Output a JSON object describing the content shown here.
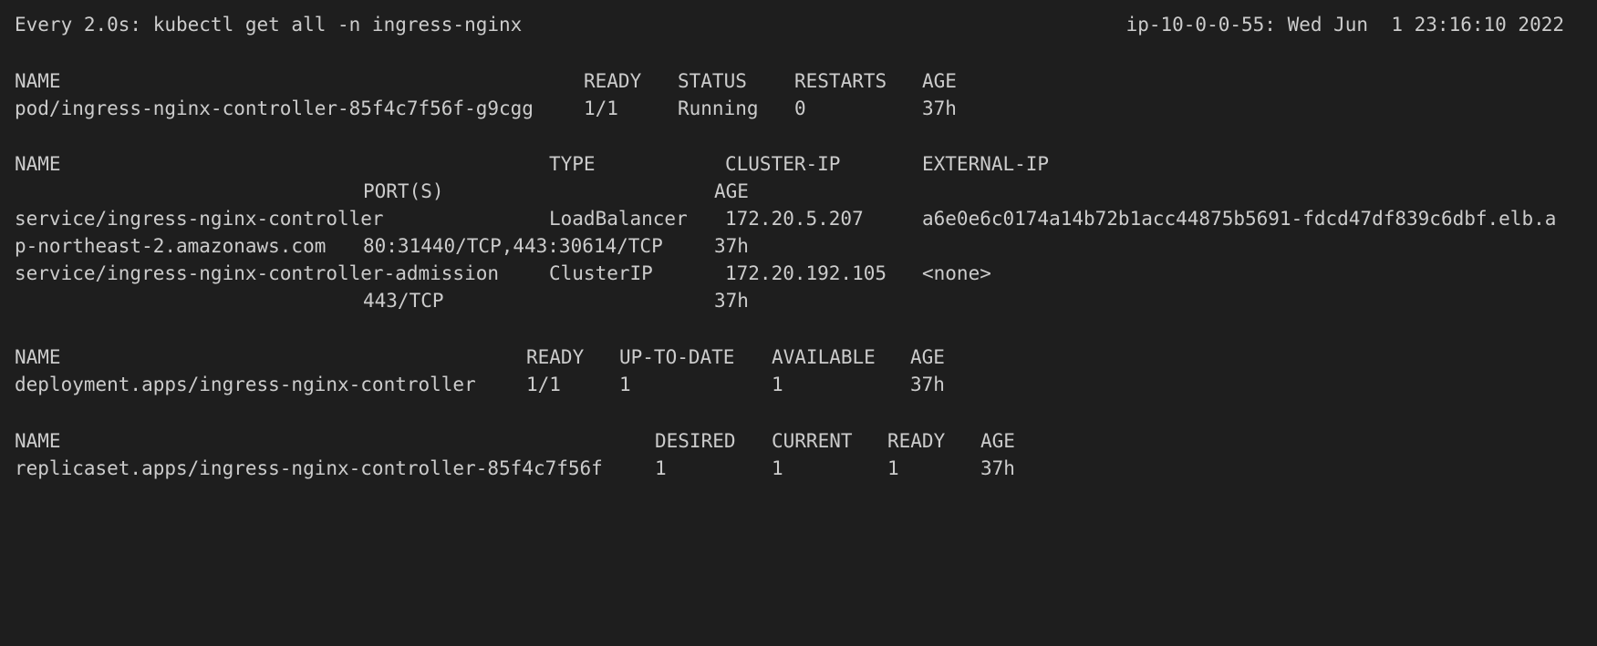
{
  "watch": {
    "left": "Every 2.0s: kubectl get all -n ingress-nginx",
    "right": "ip-10-0-0-55: Wed Jun  1 23:16:10 2022"
  },
  "pods": {
    "headers": [
      "NAME",
      "READY",
      "STATUS",
      "RESTARTS",
      "AGE"
    ],
    "rows": [
      [
        "pod/ingress-nginx-controller-85f4c7f56f-g9cgg",
        "1/1",
        "Running",
        "0",
        "37h"
      ]
    ]
  },
  "services": {
    "headers": [
      "NAME",
      "TYPE",
      "CLUSTER-IP",
      "EXTERNAL-IP",
      "PORT(S)",
      "AGE"
    ],
    "rows": [
      {
        "name": "service/ingress-nginx-controller",
        "type": "LoadBalancer",
        "cluster_ip": "172.20.5.207",
        "external_ip_part1": "a6e0e6c0174a14b72b1acc44875b5691-fdcd47df839c6dbf.elb.a",
        "external_ip_part2": "p-northeast-2.amazonaws.com",
        "ports": "80:31440/TCP,443:30614/TCP",
        "age": "37h"
      },
      {
        "name": "service/ingress-nginx-controller-admission",
        "type": "ClusterIP",
        "cluster_ip": "172.20.192.105",
        "external_ip": "<none>",
        "ports": "443/TCP",
        "age": "37h"
      }
    ]
  },
  "deployments": {
    "headers": [
      "NAME",
      "READY",
      "UP-TO-DATE",
      "AVAILABLE",
      "AGE"
    ],
    "rows": [
      [
        "deployment.apps/ingress-nginx-controller",
        "1/1",
        "1",
        "1",
        "37h"
      ]
    ]
  },
  "replicasets": {
    "headers": [
      "NAME",
      "DESIRED",
      "CURRENT",
      "READY",
      "AGE"
    ],
    "rows": [
      [
        "replicaset.apps/ingress-nginx-controller-85f4c7f56f",
        "1",
        "1",
        "1",
        "37h"
      ]
    ]
  },
  "colors": {
    "background": "#1e1e1e",
    "text": "#cccccc"
  }
}
